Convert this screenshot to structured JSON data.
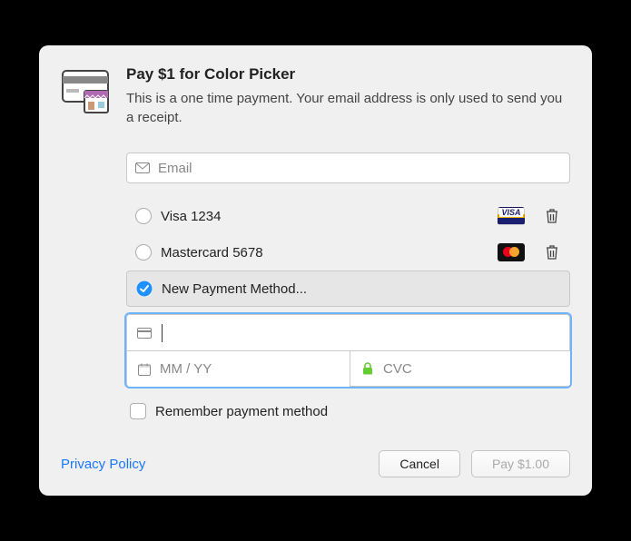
{
  "header": {
    "title": "Pay $1 for Color Picker",
    "subtitle": "This is a one time payment. Your email address is only used to send you a receipt."
  },
  "email": {
    "placeholder": "Email",
    "value": ""
  },
  "payment_methods": [
    {
      "label": "Visa 1234",
      "brand": "visa",
      "selected": false
    },
    {
      "label": "Mastercard 5678",
      "brand": "mastercard",
      "selected": false
    },
    {
      "label": "New Payment Method...",
      "brand": "new",
      "selected": true
    }
  ],
  "card": {
    "number_value": "",
    "expiry_placeholder": "MM / YY",
    "expiry_value": "",
    "cvc_placeholder": "CVC",
    "cvc_value": ""
  },
  "remember": {
    "label": "Remember payment method",
    "checked": false
  },
  "footer": {
    "privacy": "Privacy Policy",
    "cancel": "Cancel",
    "pay": "Pay $1.00"
  }
}
